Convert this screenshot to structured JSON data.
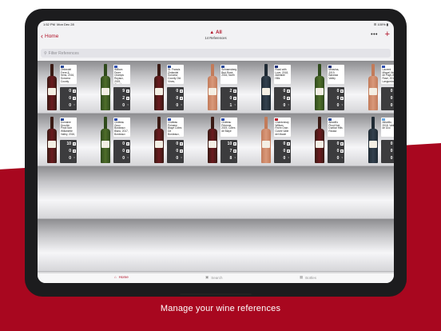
{
  "tagline": "Manage your wine references",
  "status": {
    "time": "1:52 PM",
    "date": "Mon Dec 28",
    "battery": "100%"
  },
  "nav": {
    "back_label": "Home",
    "title": "All",
    "subtitle": "14 References",
    "more": "•••",
    "add": "+"
  },
  "search": {
    "placeholder": "Filter References"
  },
  "tabs": [
    {
      "label": "Home",
      "active": true
    },
    {
      "label": "Search",
      "active": false
    },
    {
      "label": "Bottles",
      "active": false
    }
  ],
  "colors": {
    "accent": "#b01026",
    "background": "#a8071f"
  },
  "shelves": [
    [
      {
        "name": "Zinfandel Frere & Sens, 2016, Sonoma County",
        "flag": "us",
        "bottle": "red",
        "counts": [
          "0",
          "0",
          "0"
        ]
      },
      {
        "name": "William Fevre Champs Royaux, 2019, Chablis",
        "flag": "fr",
        "bottle": "white",
        "counts": [
          "9",
          "2",
          "0"
        ]
      },
      {
        "name": "St. Francis Zinfandel Sonoma County Old Vines,",
        "flag": "us",
        "bottle": "red",
        "counts": [
          "0",
          "0",
          "0"
        ]
      },
      {
        "name": "Schramsberg Brut Rosé, 2016, North",
        "flag": "us",
        "bottle": "rose",
        "counts": [
          "2",
          "0",
          "1"
        ]
      },
      {
        "name": "Road with Love, 2018, Adelaide Hills",
        "flag": "au",
        "bottle": "dark",
        "counts": [
          "0",
          "0",
          "0"
        ]
      },
      {
        "name": "Miravina, 2019, Barossa Valley",
        "flag": "au",
        "bottle": "white",
        "counts": [
          "0",
          "0",
          "0"
        ]
      },
      {
        "name": "Laurent Miquel Vin de Pays d'Oc Rosé, 2019, Languedoc",
        "flag": "fr",
        "bottle": "rose",
        "counts": [
          "0",
          "0",
          "0"
        ]
      }
    ],
    [
      {
        "name": "Domaine Drouhin Pinot Noir Willamette Valley, 2016,",
        "flag": "us",
        "bottle": "red",
        "counts": [
          "10",
          "0",
          "0"
        ]
      },
      {
        "name": "Château Goux Bordeaux Blanc, 2017, Bordeaux",
        "flag": "fr",
        "bottle": "white",
        "counts": [
          "0",
          "0",
          "0"
        ]
      },
      {
        "name": "Château Peiraine Blaye Côtes De Bordeaux,",
        "flag": "fr",
        "bottle": "red",
        "counts": [
          "0",
          "0",
          "0"
        ]
      },
      {
        "name": "Château Pérenne, 2019, Côtes de Blaye",
        "flag": "fr",
        "bottle": "red",
        "counts": [
          "10",
          "7",
          "8"
        ]
      },
      {
        "name": "Chardonnay William Fevre Gran Cuvée Valle del Maule",
        "flag": "cl",
        "bottle": "rose",
        "counts": [
          "0",
          "0",
          "0"
        ]
      },
      {
        "name": "Albariño Pinot Noir Dunbar Hills Ricasa",
        "flag": "us",
        "bottle": "red",
        "counts": [
          "0",
          "0",
          "0"
        ]
      },
      {
        "name": "Albarillo, 2018, Valle de Uco",
        "flag": "ar",
        "bottle": "dark",
        "counts": [
          "0",
          "0",
          "0"
        ]
      }
    ]
  ]
}
